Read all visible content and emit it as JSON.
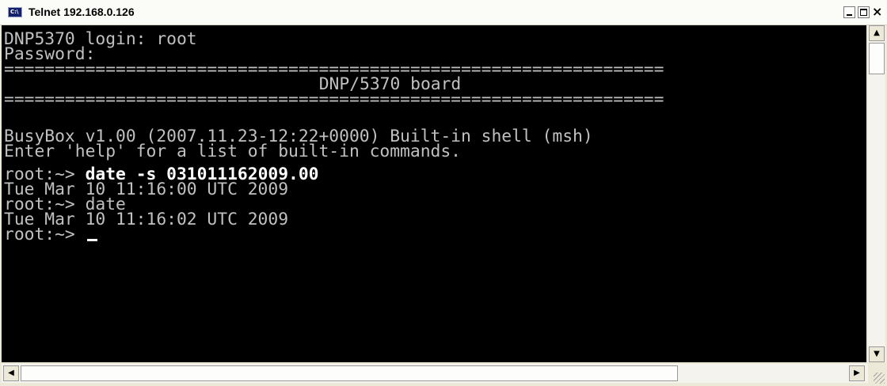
{
  "window": {
    "title": "Telnet 192.168.0.126",
    "icon": "console-icon",
    "controls": {
      "minimize": "minimize",
      "maximize": "maximize",
      "close": "×"
    }
  },
  "terminal": {
    "lines": [
      "DNP5370 login: root",
      "Password:",
      "=================================================================",
      "DNP/5370 board",
      "=================================================================",
      "BusyBox v1.00 (2007.11.23-12:22+0000) Built-in shell (msh)",
      "Enter 'help' for a list of built-in commands.",
      "root:~>",
      "date -s 031011162009.00",
      "Tue Mar 10 11:16:00 UTC 2009",
      "root:~>",
      "date",
      "Tue Mar 10 11:16:02 UTC 2009",
      "root:~>"
    ]
  },
  "scrollbars": {
    "up_arrow": "▲",
    "down_arrow": "▼",
    "left_arrow": "◀",
    "right_arrow": "▶"
  },
  "colors": {
    "terminal_bg": "#000000",
    "terminal_fg": "#c0c0c0",
    "input_fg": "#ffffff"
  }
}
